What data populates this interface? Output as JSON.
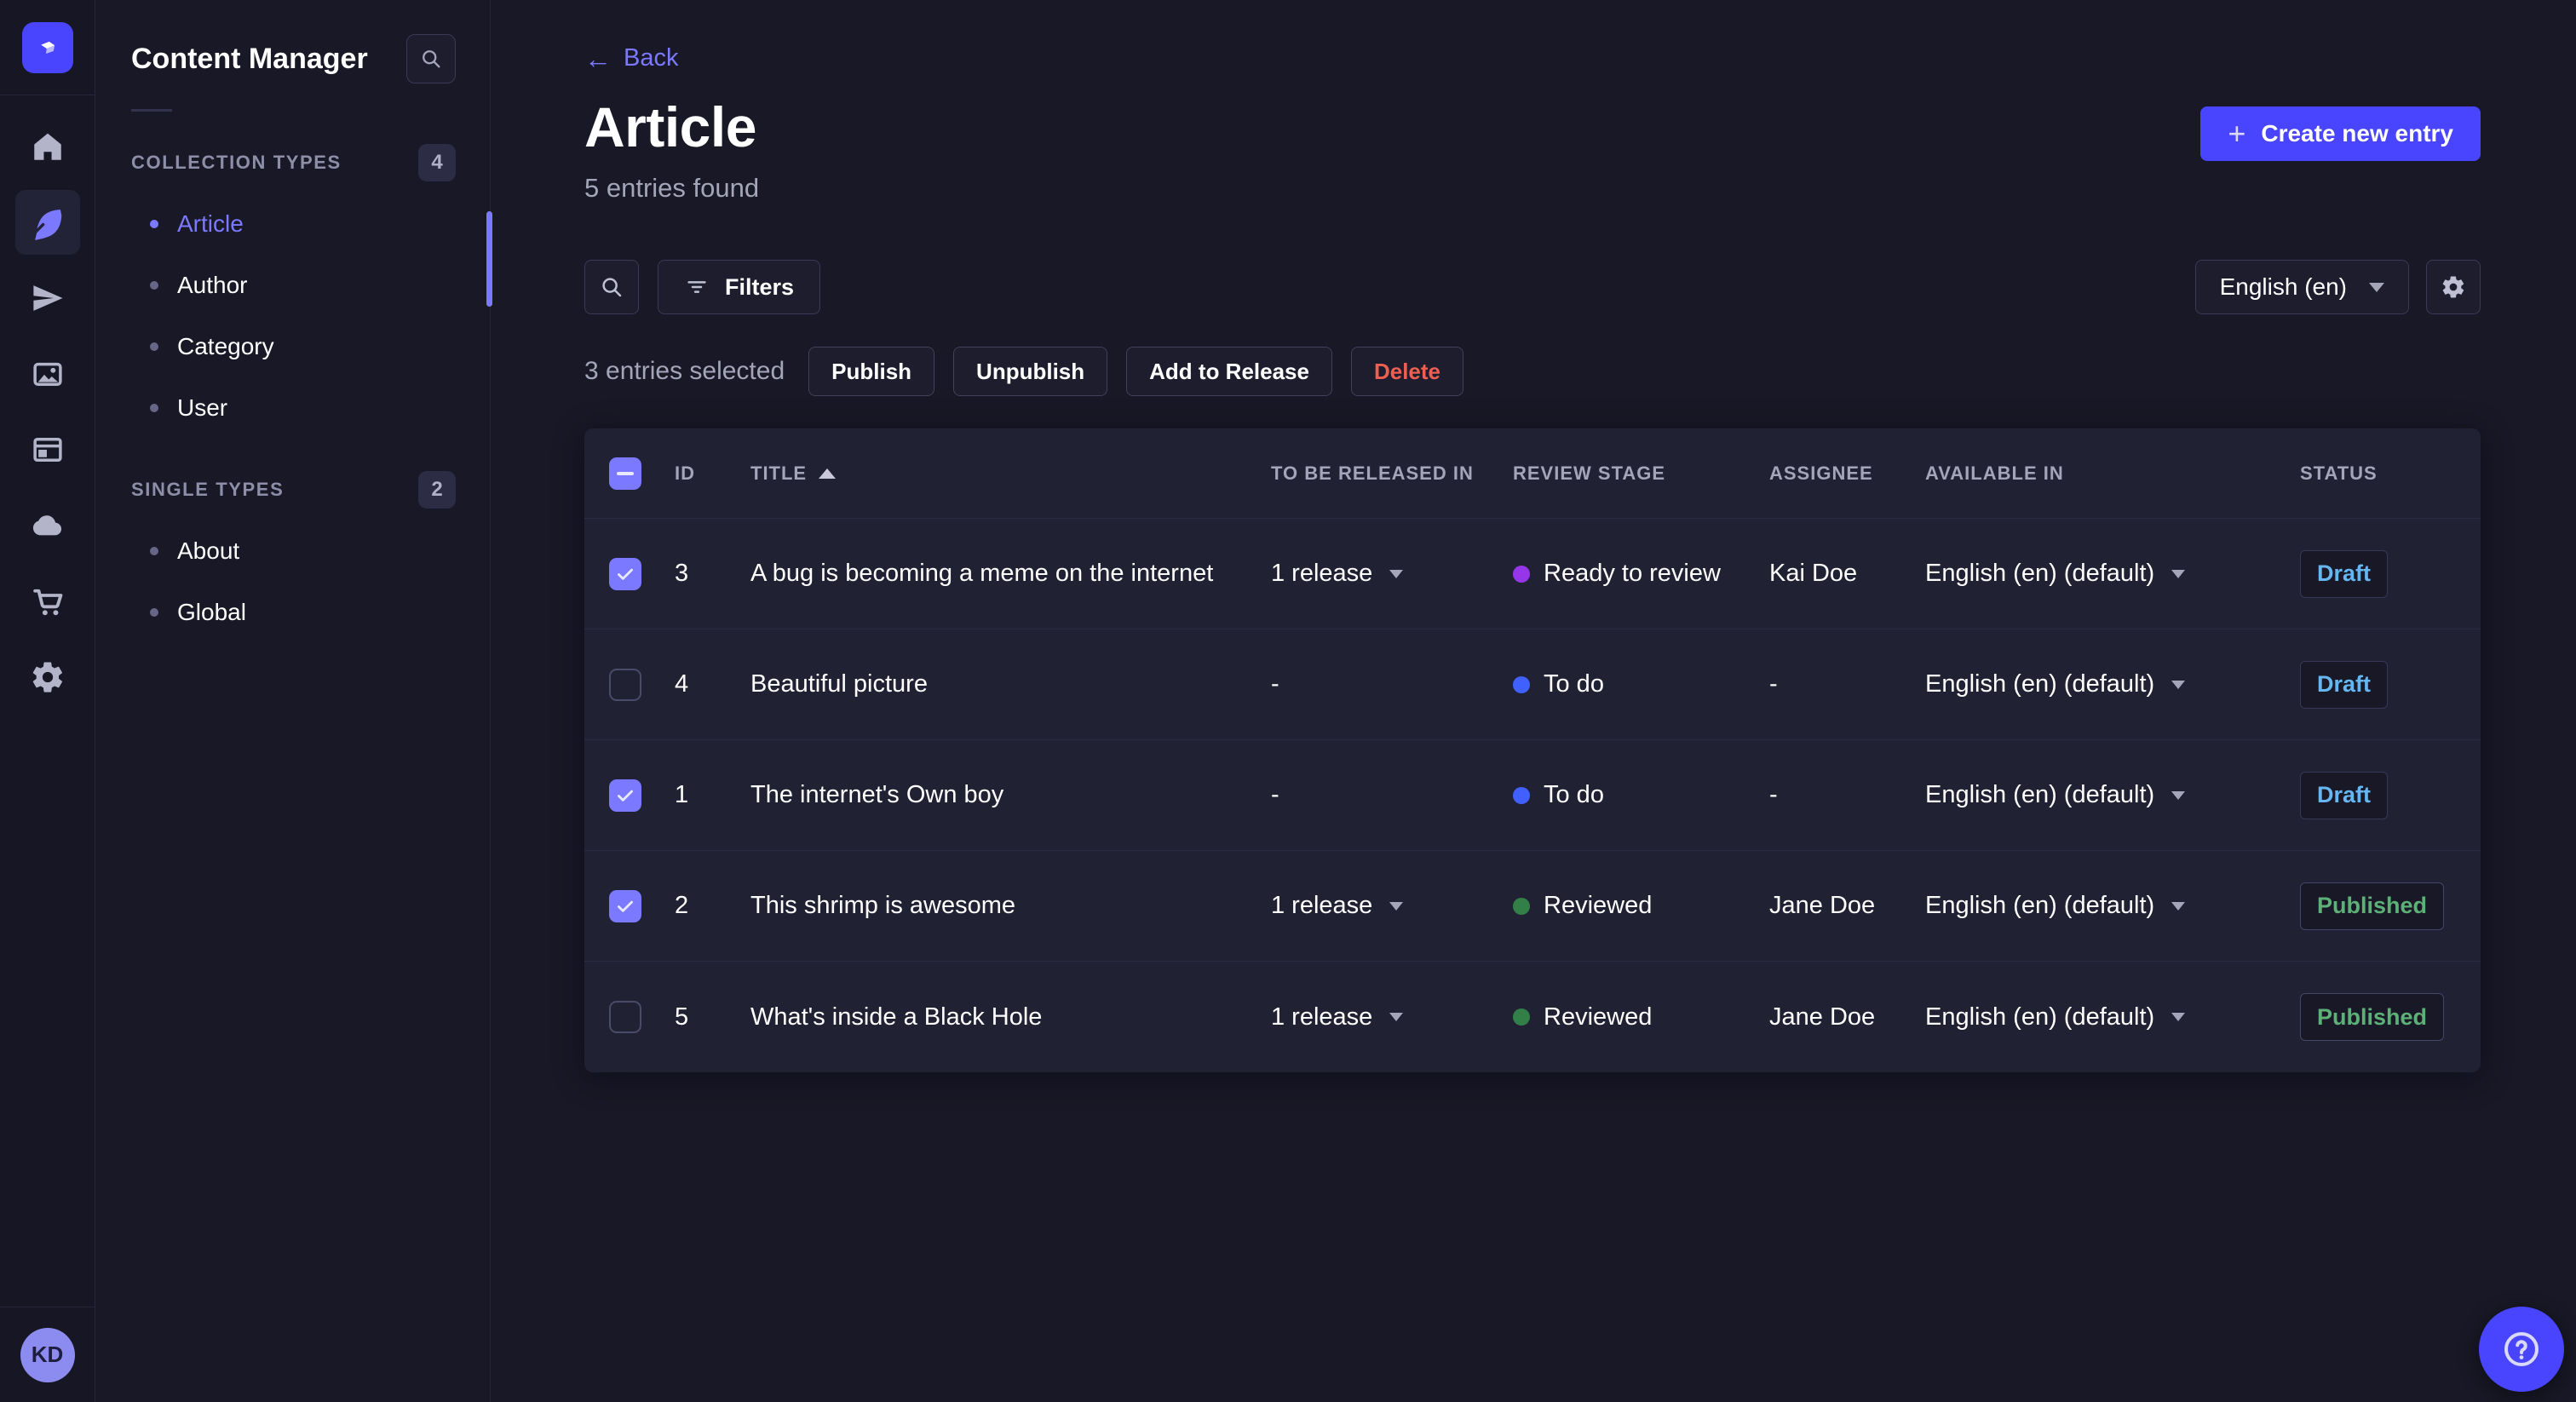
{
  "colors": {
    "accent": "#4945ff",
    "link": "#7b79ff",
    "draft": "#66b7f1",
    "published": "#5cb176",
    "danger": "#ee5e52",
    "stage_ready": "#9736e8",
    "stage_todo": "#4060ff",
    "stage_reviewed": "#328048"
  },
  "rail": {
    "items": [
      {
        "name": "home",
        "icon": "home-icon",
        "active": false
      },
      {
        "name": "content-manager",
        "icon": "feather-icon",
        "active": true
      },
      {
        "name": "releases",
        "icon": "paper-plane-icon",
        "active": false
      },
      {
        "name": "media-library",
        "icon": "images-icon",
        "active": false
      },
      {
        "name": "content-type-builder",
        "icon": "layout-icon",
        "active": false
      },
      {
        "name": "deploy",
        "icon": "cloud-icon",
        "active": false
      },
      {
        "name": "marketplace",
        "icon": "cart-icon",
        "active": false
      },
      {
        "name": "settings",
        "icon": "gear-icon",
        "active": false
      }
    ],
    "avatar_initials": "KD"
  },
  "subnav": {
    "title": "Content Manager",
    "sections": [
      {
        "label": "COLLECTION TYPES",
        "badge": "4",
        "items": [
          {
            "label": "Article",
            "active": true
          },
          {
            "label": "Author",
            "active": false
          },
          {
            "label": "Category",
            "active": false
          },
          {
            "label": "User",
            "active": false
          }
        ]
      },
      {
        "label": "SINGLE TYPES",
        "badge": "2",
        "items": [
          {
            "label": "About",
            "active": false
          },
          {
            "label": "Global",
            "active": false
          }
        ]
      }
    ]
  },
  "header": {
    "back_label": "Back",
    "title": "Article",
    "subtitle": "5 entries found",
    "create_button": "Create new entry"
  },
  "toolbar": {
    "filters_label": "Filters",
    "locale_value": "English (en)"
  },
  "selection": {
    "summary": "3 entries selected",
    "actions": [
      {
        "label": "Publish",
        "variant": "default"
      },
      {
        "label": "Unpublish",
        "variant": "default"
      },
      {
        "label": "Add to Release",
        "variant": "default"
      },
      {
        "label": "Delete",
        "variant": "danger"
      }
    ]
  },
  "table": {
    "columns": [
      "ID",
      "TITLE",
      "TO BE RELEASED IN",
      "REVIEW STAGE",
      "ASSIGNEE",
      "AVAILABLE IN",
      "STATUS"
    ],
    "sort": {
      "column": "TITLE",
      "direction": "asc"
    },
    "select_all_state": "indeterminate",
    "rows": [
      {
        "selected": true,
        "id": "3",
        "title": "A bug is becoming a meme on the internet",
        "to_be_released_in": "1 release",
        "review_stage": "Ready to review",
        "stage_color_key": "stage_ready",
        "assignee": "Kai Doe",
        "available_in": "English (en) (default)",
        "status": "Draft"
      },
      {
        "selected": false,
        "id": "4",
        "title": "Beautiful picture",
        "to_be_released_in": "-",
        "review_stage": "To do",
        "stage_color_key": "stage_todo",
        "assignee": "-",
        "available_in": "English (en) (default)",
        "status": "Draft"
      },
      {
        "selected": true,
        "id": "1",
        "title": "The internet's Own boy",
        "to_be_released_in": "-",
        "review_stage": "To do",
        "stage_color_key": "stage_todo",
        "assignee": "-",
        "available_in": "English (en) (default)",
        "status": "Draft"
      },
      {
        "selected": true,
        "id": "2",
        "title": "This shrimp is awesome",
        "to_be_released_in": "1 release",
        "review_stage": "Reviewed",
        "stage_color_key": "stage_reviewed",
        "assignee": "Jane Doe",
        "available_in": "English (en) (default)",
        "status": "Published"
      },
      {
        "selected": false,
        "id": "5",
        "title": "What's inside a Black Hole",
        "to_be_released_in": "1 release",
        "review_stage": "Reviewed",
        "stage_color_key": "stage_reviewed",
        "assignee": "Jane Doe",
        "available_in": "English (en) (default)",
        "status": "Published"
      }
    ]
  },
  "help": {
    "icon": "question-mark-icon"
  }
}
